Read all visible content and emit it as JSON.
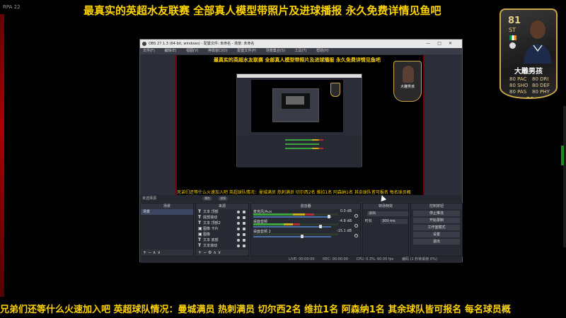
{
  "stream": {
    "mini_app_title": "RPA 22",
    "top_banner": "最真实的英超水友联赛 全部真人模型带照片及进球播报 永久免费详情见鱼吧",
    "bottom_banner": "兄弟们还等什么火速加入吧  英超球队情况：曼城满员 热刺满员 切尔西2名 维拉1名 阿森纳1名 其余球队皆可报名 每名球员概"
  },
  "player_card": {
    "rating": "81",
    "position": "ST",
    "name": "大雕男孩",
    "stats": [
      "80 PAC",
      "80 DRI",
      "80 SHO",
      "80 DEF",
      "80 PAS",
      "80 PHY"
    ],
    "logo": "FC",
    "flag_colors": [
      "#008f3c",
      "#ffffff",
      "#f08a00"
    ]
  },
  "obs": {
    "title": "OBS 27.1.3 (64-bit, windows) - 配置文件: 未命名 - 场景: 未命名",
    "menu": [
      "文件(F)",
      "编辑(E)",
      "视图(V)",
      "停靠窗口(D)",
      "配置文件(P)",
      "场景集合(S)",
      "工具(T)",
      "帮助(H)"
    ],
    "preview": {
      "top_text": "最真实的英超水友联赛 全部真人模型带照片及进球播报 永久免费详情见鱼吧",
      "bottom_text": "兄弟们还等什么火速加入吧  英超球队情况：曼城满员 热刺满员 切尔西2名 维拉1名 阿森纳1名 其余球队皆可报名 每名球员概",
      "card_name": "大雕男孩"
    },
    "source_bar": {
      "label": "未选择源",
      "properties": "属性",
      "filters": "滤镜"
    },
    "scenes": {
      "header": "场景",
      "items": [
        "场景"
      ]
    },
    "sources": {
      "header": "来源",
      "items": [
        {
          "icon": "T",
          "label": "文本 顶部"
        },
        {
          "icon": "T",
          "label": "底部滚动"
        },
        {
          "icon": "T",
          "label": "文本 顶部2"
        },
        {
          "icon": "img",
          "label": "图像 卡片"
        },
        {
          "icon": "img",
          "label": "图像"
        },
        {
          "icon": "T",
          "label": "文本 底部"
        },
        {
          "icon": "T",
          "label": "文本滚动"
        }
      ]
    },
    "mixer": {
      "header": "混音器",
      "channels": [
        {
          "name": "麦克风/Aux",
          "db": "0.0 dB",
          "level": 0.72
        },
        {
          "name": "桌面音频",
          "db": "-4.8 dB",
          "level": 0.55
        },
        {
          "name": "桌面音频 2",
          "db": "-15.1 dB",
          "level": 0.0
        }
      ]
    },
    "transitions": {
      "header": "转场特效",
      "type": "淡出",
      "duration_label": "时长",
      "duration_value": "300 ms"
    },
    "controls": {
      "header": "控制按钮",
      "buttons": [
        "停止推流",
        "开始录制",
        "工作室模式",
        "设置",
        "退出"
      ]
    },
    "status": [
      "LIVE: 00:00:00",
      "REC: 00:00:00",
      "CPU: 0.3%, 60.00 fps"
    ],
    "status_right": "编码 (1 秒钟丢帧 0%)"
  }
}
